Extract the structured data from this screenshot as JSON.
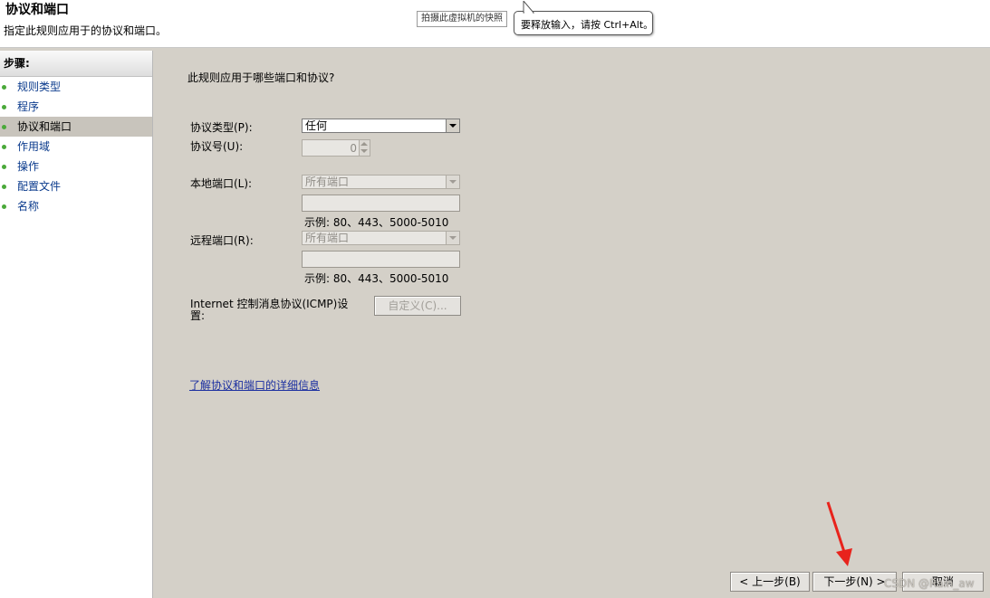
{
  "header": {
    "title": "协议和端口",
    "subtitle": "指定此规则应用于的协议和端口。"
  },
  "snapshot_tooltip": "拍摄此虚拟机的快照",
  "release_balloon": "要释放输入，请按 Ctrl+Alt。",
  "sidebar": {
    "header": "步骤:",
    "items": [
      {
        "label": "规则类型",
        "current": false
      },
      {
        "label": "程序",
        "current": false
      },
      {
        "label": "协议和端口",
        "current": true
      },
      {
        "label": "作用域",
        "current": false
      },
      {
        "label": "操作",
        "current": false
      },
      {
        "label": "配置文件",
        "current": false
      },
      {
        "label": "名称",
        "current": false
      }
    ],
    "bullet_color": "#4aa93a"
  },
  "main": {
    "question": "此规则应用于哪些端口和协议?",
    "protocol_type_label": "协议类型(P):",
    "protocol_type_value": "任何",
    "protocol_number_label": "协议号(U):",
    "protocol_number_value": "0",
    "local_port_label": "本地端口(L):",
    "local_port_value": "所有端口",
    "local_port_example": "示例: 80、443、5000-5010",
    "remote_port_label": "远程端口(R):",
    "remote_port_value": "所有端口",
    "remote_port_example": "示例: 80、443、5000-5010",
    "icmp_label_line1": "Internet 控制消息协议(ICMP)设",
    "icmp_label_line2": "置:",
    "customize_button": "自定义(C)...",
    "learn_more_link": "了解协议和端口的详细信息"
  },
  "footer": {
    "back_button": "< 上一步(B)",
    "next_button": "下一步(N) >",
    "cancel_button": "取消"
  },
  "watermark": "CSDN @Rain_aw",
  "annotation_arrow_color": "#e8231c"
}
